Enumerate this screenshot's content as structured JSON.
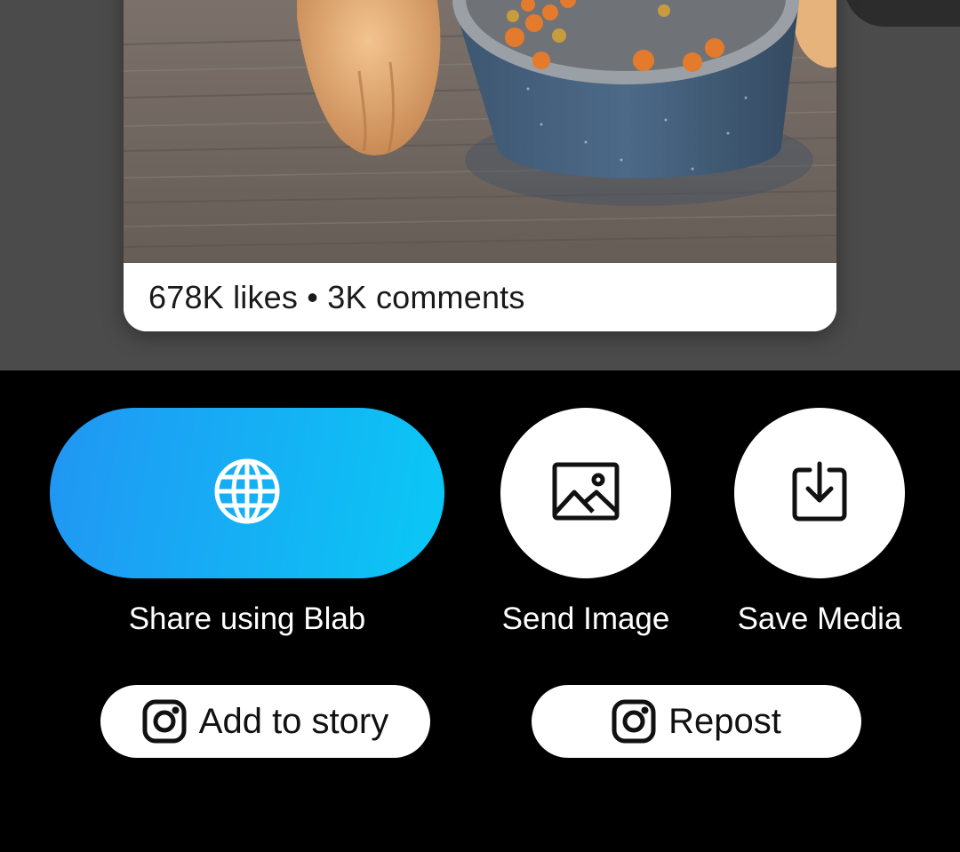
{
  "post": {
    "stats_text": "678K likes • 3K comments"
  },
  "share_options": {
    "blab": {
      "label": "Share using Blab",
      "icon": "globe-icon"
    },
    "send_image": {
      "label": "Send Image",
      "icon": "image-icon"
    },
    "save_media": {
      "label": "Save Media",
      "icon": "download-icon"
    }
  },
  "instagram_actions": {
    "add_to_story": {
      "label": "Add to story",
      "icon": "instagram-icon"
    },
    "repost": {
      "label": "Repost",
      "icon": "instagram-icon"
    }
  },
  "colors": {
    "sheet_background": "#000000",
    "dim_overlay": "#4b4b4b",
    "blab_gradient_start": "#2196f3",
    "blab_gradient_end": "#0ac8f5"
  }
}
